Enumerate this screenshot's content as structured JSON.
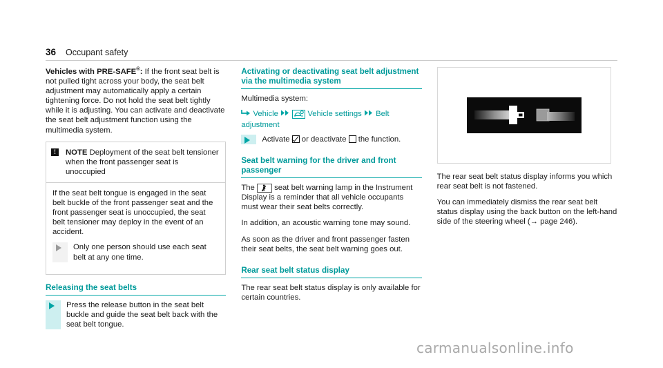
{
  "header": {
    "page_number": "36",
    "chapter": "Occupant safety"
  },
  "left_column": {
    "intro": {
      "lead_bold": "Vehicles with PRE-SAFE",
      "lead_registered": "®",
      "lead_colon": ":",
      "text": " If the front seat belt is not pulled tight across your body, the seat belt adjustment may automatically apply a certain tightening force. Do not hold the seat belt tightly while it is adjusting. You can activate and deactivate the seat belt adjustment function using the multimedia system."
    },
    "notebox": {
      "glyph": "warning-exclamation-icon",
      "glyph_char": "!",
      "label": "NOTE",
      "title": " Deployment of the seat belt tensioner when the front passenger seat is unoccupied",
      "paragraph": "If the seat belt tongue is engaged in the seat belt buckle of the front passenger seat and the front passenger seat is unoccupied, the seat belt tensioner may deploy in the event of an accident.",
      "action": "Only one person should use each seat belt at any one time."
    },
    "releasing": {
      "heading": "Releasing the seat belts",
      "action": "Press the release button in the seat belt buckle and guide the seat belt back with the seat belt tongue."
    }
  },
  "middle_column": {
    "activating": {
      "heading": "Activating or deactivating seat belt adjustment via the multimedia system",
      "intro": "Multimedia system:",
      "path": {
        "enter_icon": "enter-arrow-icon",
        "item1": "Vehicle",
        "sep1_icon": "double-arrow-icon",
        "settings_icon": "vehicle-settings-icon",
        "item2": "Vehicle settings",
        "sep2_icon": "double-arrow-icon",
        "item3": "Belt adjustment"
      },
      "action_pre": "Activate",
      "action_mid": "or deactivate",
      "action_post": "the function.",
      "checkbox_checked": "checkbox-checked-icon",
      "checkbox_empty": "checkbox-empty-icon"
    },
    "warning": {
      "heading": "Seat belt warning for the driver and front passenger",
      "lamp_icon": "seat-belt-warning-lamp-icon",
      "para1_pre": "The",
      "para1_post": "seat belt warning lamp in the Instrument Display is a reminder that all vehicle occupants must wear their seat belts correctly.",
      "para2": "In addition, an acoustic warning tone may sound.",
      "para3": "As soon as the driver and front passenger fasten their seat belts, the seat belt warning goes out."
    },
    "rear_status": {
      "heading": "Rear seat belt status display",
      "para1": "The rear seat belt status display is only available for certain countries."
    }
  },
  "right_column": {
    "figure": {
      "name": "rear-seat-belt-status-display-image",
      "alt": "Rear seat belt status display graphic"
    },
    "para1": "The rear seat belt status display informs you which rear seat belt is not fastened.",
    "para2_a": "You can immediately dismiss the rear seat belt status display using the back button on the left-hand side of the steering wheel (",
    "para2_arrow": "→",
    "para2_b": " page 246)."
  },
  "watermark": {
    "text": "carmanualsonline.info"
  },
  "colors": {
    "accent_teal": "#009a9a",
    "rule_teal": "#00a5a5",
    "marker_gray": "#9a9a9a",
    "marker_bg_gray": "#f2f2f2",
    "marker_bg_teal": "#cdeff0",
    "text": "#1a1a1a",
    "watermark": "#a9a9a9"
  }
}
